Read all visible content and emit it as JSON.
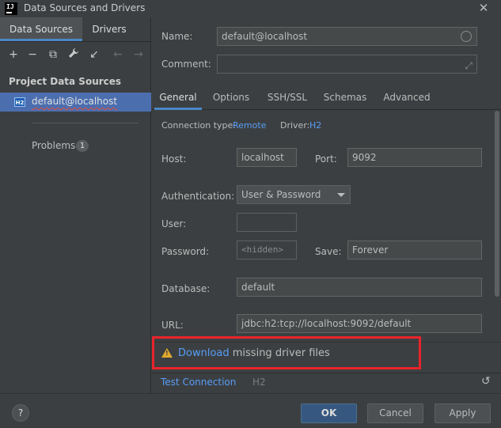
{
  "window": {
    "title": "Data Sources and Drivers",
    "close_glyph": "✕"
  },
  "left": {
    "tabs": [
      {
        "label": "Data Sources"
      },
      {
        "label": "Drivers"
      }
    ],
    "toolbar": [
      {
        "icon": "add-icon",
        "glyph": "+"
      },
      {
        "icon": "remove-icon",
        "glyph": "−"
      },
      {
        "icon": "duplicate-icon",
        "glyph": "⧉"
      },
      {
        "icon": "wrench-icon",
        "glyph": "🔧"
      },
      {
        "icon": "import-icon",
        "glyph": "↙"
      },
      {
        "icon": "back-arrow-icon",
        "glyph": "←"
      },
      {
        "icon": "forward-arrow-icon",
        "glyph": "→"
      }
    ],
    "section_title": "Project Data Sources",
    "data_source": {
      "badge": "H2",
      "label": "default@localhost"
    },
    "problems": {
      "label": "Problems",
      "count": "1"
    }
  },
  "form": {
    "name_label": "Name:",
    "name_value": "default@localhost",
    "comment_label": "Comment:",
    "comment_value": "",
    "tabs": [
      {
        "label": "General"
      },
      {
        "label": "Options"
      },
      {
        "label": "SSH/SSL"
      },
      {
        "label": "Schemas"
      },
      {
        "label": "Advanced"
      }
    ],
    "connection_type_label": "Connection type:",
    "connection_type_value": "Remote",
    "driver_label": "Driver:",
    "driver_value": "H2",
    "host_label": "Host:",
    "host_value": "localhost",
    "port_label": "Port:",
    "port_value": "9092",
    "auth_label": "Authentication:",
    "auth_value": "User & Password",
    "user_label": "User:",
    "user_value": "",
    "password_label": "Password:",
    "password_value": "<hidden>",
    "save_label": "Save:",
    "save_value": "Forever",
    "database_label": "Database:",
    "database_value": "default",
    "url_label": "URL:",
    "url_value": "jdbc:h2:tcp://localhost:9092/default",
    "warning": {
      "link": "Download",
      "text": " missing driver files"
    },
    "test_connection": "Test Connection",
    "test_driver": "H2"
  },
  "buttons": {
    "help": "?",
    "ok": "OK",
    "cancel": "Cancel",
    "apply": "Apply"
  },
  "colors": {
    "accent": "#4a88c7",
    "link": "#589df6",
    "highlight": "#e8232b",
    "warning": "#e0a82e"
  }
}
